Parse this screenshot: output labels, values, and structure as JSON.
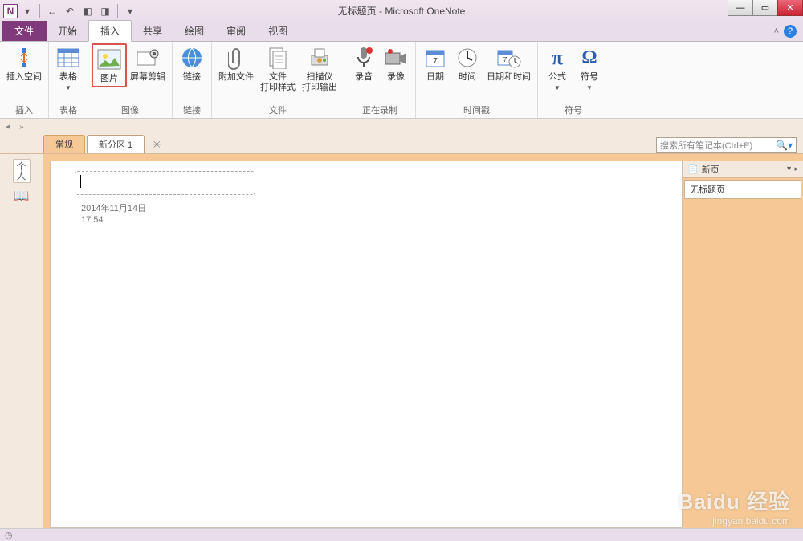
{
  "title": "无标题页 - Microsoft OneNote",
  "app_letter": "N",
  "tabs": {
    "file": "文件",
    "home": "开始",
    "insert": "插入",
    "share": "共享",
    "draw": "绘图",
    "review": "审阅",
    "view": "视图"
  },
  "ribbon": {
    "groups": {
      "insert": "插入",
      "tables": "表格",
      "images": "图像",
      "links": "链接",
      "files": "文件",
      "recording": "正在录制",
      "timestamp": "时间戳",
      "symbols": "符号"
    },
    "buttons": {
      "insert_space": "插入空间",
      "table": "表格",
      "picture": "图片",
      "screen_clip": "屏幕剪辑",
      "link": "链接",
      "attach": "附加文件",
      "file_printout": "文件\n打印样式",
      "scanner": "扫描仪\n打印输出",
      "audio": "录音",
      "video": "录像",
      "date": "日期",
      "time": "时间",
      "datetime": "日期和时间",
      "equation": "公式",
      "symbol": "符号"
    }
  },
  "sections": {
    "general": "常规",
    "new_section": "新分区 1"
  },
  "search_placeholder": "搜索所有笔记本(Ctrl+E)",
  "pages": {
    "header": "新页",
    "untitled": "无标题页"
  },
  "note": {
    "date": "2014年11月14日",
    "time": "17:54"
  },
  "rail": {
    "personal": "个人"
  },
  "watermark": {
    "brand": "Baidu 经验",
    "url": "jingyan.baidu.com"
  }
}
